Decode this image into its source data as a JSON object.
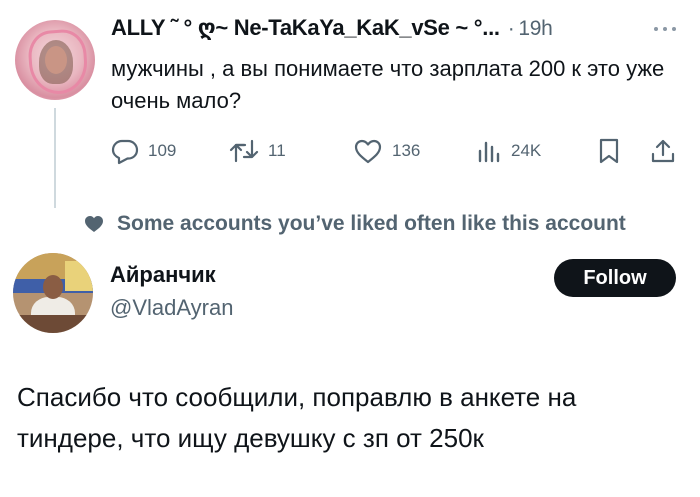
{
  "first_tweet": {
    "author_name": "ALLY ˜ ° ღ~ Ne-TaKaYa_KaK_vSe ~ °...",
    "separator": "·",
    "time": "19h",
    "text": "мужчины , а вы понимаете что зарплата 200 к это уже очень мало?",
    "actions": {
      "replies": "109",
      "reposts": "11",
      "likes": "136",
      "views": "24K"
    }
  },
  "social_context": {
    "text": "Some accounts you’ve liked often like this account"
  },
  "reply_user": {
    "display_name": "Айранчик",
    "handle": "@VladAyran",
    "follow_label": "Follow"
  },
  "reply_tweet": {
    "text": "Спасибо что сообщили, поправлю в анкете на тиндере, что ищу девушку с зп от 250к"
  },
  "colors": {
    "text_primary": "#0f1419",
    "text_secondary": "#536471",
    "thread_line": "#cfd9de",
    "follow_button_bg": "#0f1419"
  },
  "icons": [
    "more-icon",
    "reply-icon",
    "repost-icon",
    "like-icon",
    "views-icon",
    "bookmark-icon",
    "share-icon",
    "heart-icon"
  ]
}
